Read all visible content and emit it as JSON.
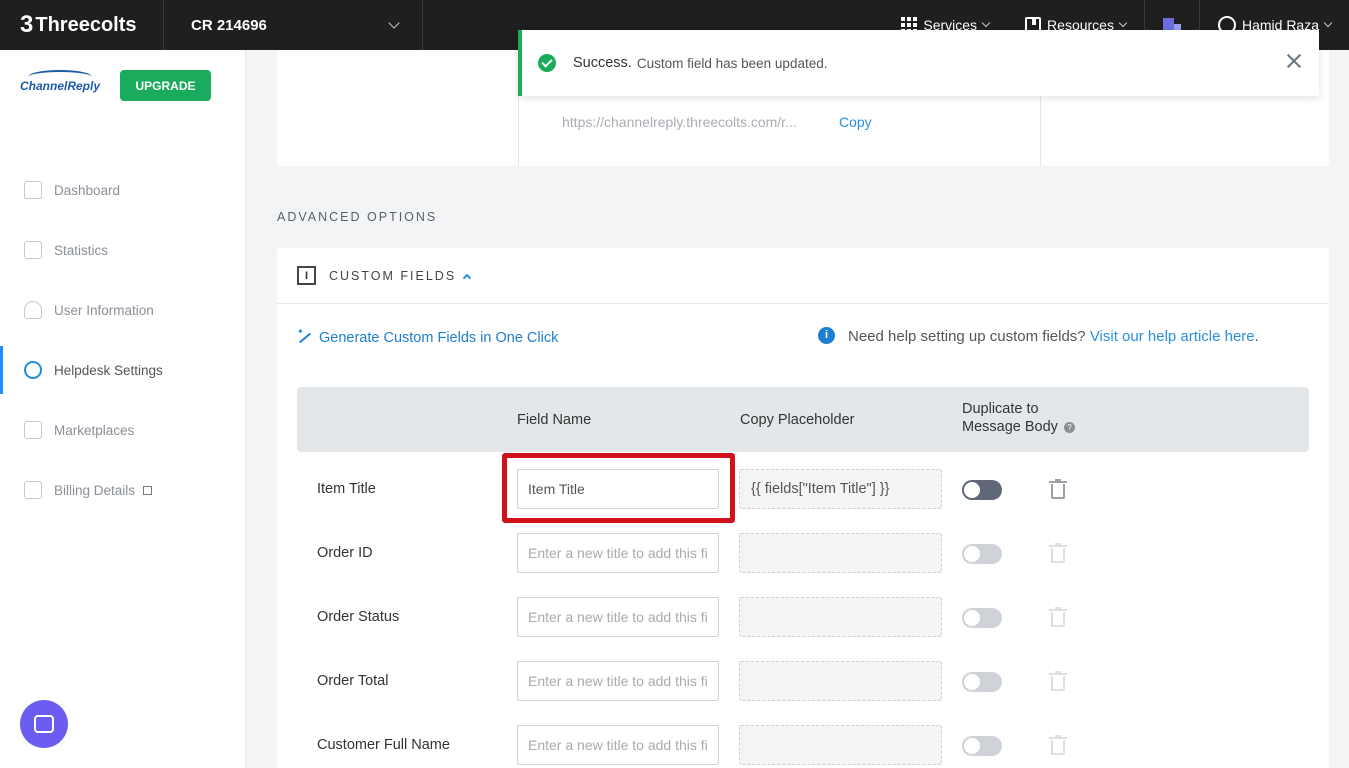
{
  "topbar": {
    "brand": "Threecolts",
    "brand_mark": "3",
    "account": "CR 214696",
    "services": "Services",
    "resources": "Resources",
    "user": "Hamid Raza"
  },
  "sidebar": {
    "logo_text": "ChannelReply",
    "upgrade": "UPGRADE",
    "items": [
      {
        "label": "Dashboard",
        "icon": "home-icon"
      },
      {
        "label": "Statistics",
        "icon": "clipboard-icon"
      },
      {
        "label": "User Information",
        "icon": "user-icon"
      },
      {
        "label": "Helpdesk Settings",
        "icon": "gear-icon"
      },
      {
        "label": "Marketplaces",
        "icon": "store-icon"
      },
      {
        "label": "Billing Details",
        "icon": "billing-icon"
      }
    ]
  },
  "toast": {
    "title": "Success.",
    "message": "Custom field has been updated."
  },
  "top_card": {
    "url": "https://channelreply.threecolts.com/r...",
    "copy": "Copy"
  },
  "advanced": {
    "title": "ADVANCED OPTIONS"
  },
  "custom_fields": {
    "title": "CUSTOM FIELDS",
    "generate": "Generate Custom Fields in One Click",
    "help_text": "Need help setting up custom fields?",
    "help_link": "Visit our help article here",
    "help_period": ".",
    "col_field_name": "Field Name",
    "col_copy": "Copy Placeholder",
    "col_dup_1": "Duplicate to",
    "col_dup_2": "Message Body",
    "input_placeholder": "Enter a new title to add this field",
    "rows": [
      {
        "label": "Item Title",
        "value": "Item Title",
        "placeholder": "{{ fields[\"Item Title\"] }}"
      },
      {
        "label": "Order ID",
        "value": "",
        "placeholder": ""
      },
      {
        "label": "Order Status",
        "value": "",
        "placeholder": ""
      },
      {
        "label": "Order Total",
        "value": "",
        "placeholder": ""
      },
      {
        "label": "Customer Full Name",
        "value": "",
        "placeholder": ""
      }
    ]
  },
  "colors": {
    "accent": "#1e7fd0",
    "success": "#1aac5c",
    "highlight": "#d0111b",
    "topbar": "#1f1f1f"
  }
}
